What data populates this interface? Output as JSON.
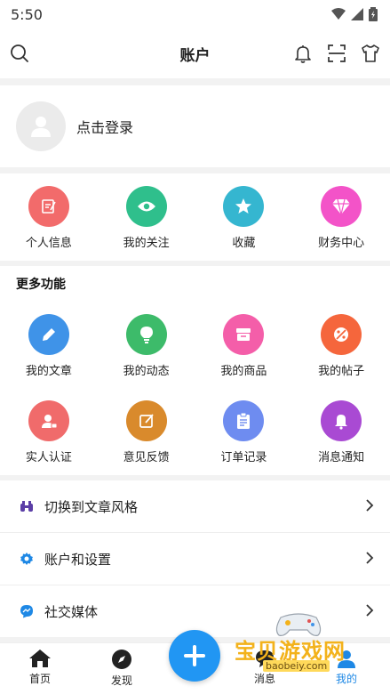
{
  "status_bar": {
    "time": "5:50"
  },
  "header": {
    "title": "账户"
  },
  "login": {
    "label": "点击登录"
  },
  "quick_actions": [
    {
      "label": "个人信息",
      "color": "#f26b6b",
      "icon": "edit-note-icon"
    },
    {
      "label": "我的关注",
      "color": "#2fbf8c",
      "icon": "eye-icon"
    },
    {
      "label": "收藏",
      "color": "#35b6d0",
      "icon": "star-icon"
    },
    {
      "label": "财务中心",
      "color": "#f353c8",
      "icon": "diamond-icon"
    }
  ],
  "more": {
    "title": "更多功能",
    "items": [
      {
        "label": "我的文章",
        "color": "#3f93e8",
        "icon": "pencil-icon"
      },
      {
        "label": "我的动态",
        "color": "#3dbb6a",
        "icon": "bulb-icon"
      },
      {
        "label": "我的商品",
        "color": "#f45ea9",
        "icon": "store-icon"
      },
      {
        "label": "我的帖子",
        "color": "#f5663c",
        "icon": "post-icon"
      },
      {
        "label": "实人认证",
        "color": "#f06b6b",
        "icon": "id-card-icon"
      },
      {
        "label": "意见反馈",
        "color": "#d98a2c",
        "icon": "feedback-icon"
      },
      {
        "label": "订单记录",
        "color": "#6e8cf0",
        "icon": "clipboard-icon"
      },
      {
        "label": "消息通知",
        "color": "#a94ad3",
        "icon": "bell-icon"
      }
    ]
  },
  "menu": [
    {
      "label": "切换到文章风格",
      "color": "#5b3ea6",
      "icon": "binoculars-icon"
    },
    {
      "label": "账户和设置",
      "color": "#1e88e5",
      "icon": "gear-icon"
    },
    {
      "label": "社交媒体",
      "color": "#1e88e5",
      "icon": "messenger-icon"
    }
  ],
  "tabbar": {
    "home": "首页",
    "discover": "发现",
    "tab4": "消息",
    "mine": "我的",
    "accent": "#2196f3"
  },
  "watermark": {
    "text": "宝贝游戏网",
    "url": "baobeiy.com"
  }
}
